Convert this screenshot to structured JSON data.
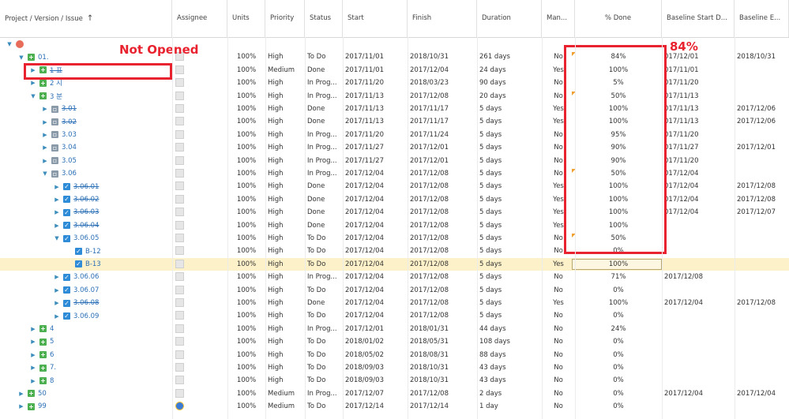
{
  "columns": [
    {
      "key": "name",
      "label": "Project / Version / Issue",
      "sort_icon": "↑"
    },
    {
      "key": "assignee",
      "label": "Assignee"
    },
    {
      "key": "units",
      "label": "Units"
    },
    {
      "key": "priority",
      "label": "Priority"
    },
    {
      "key": "status",
      "label": "Status"
    },
    {
      "key": "start",
      "label": "Start"
    },
    {
      "key": "finish",
      "label": "Finish"
    },
    {
      "key": "duration",
      "label": "Duration"
    },
    {
      "key": "manual",
      "label": "Man..."
    },
    {
      "key": "done",
      "label": "% Done"
    },
    {
      "key": "bstart",
      "label": "Baseline Start D..."
    },
    {
      "key": "bend",
      "label": "Baseline E..."
    }
  ],
  "rows": [
    {
      "level": 0,
      "arrow": "down",
      "icon": "proj",
      "name": "",
      "strike": false,
      "units": "",
      "priority": "",
      "status": "",
      "start": "",
      "finish": "",
      "duration": "",
      "manual": "",
      "done": "",
      "bstart": "",
      "bend": "",
      "flag": false,
      "avatar": false
    },
    {
      "level": 1,
      "arrow": "down",
      "icon": "plus",
      "name": "01.",
      "strike": false,
      "units": "100%",
      "priority": "High",
      "status": "To Do",
      "start": "2017/11/01",
      "finish": "2018/10/31",
      "duration": "261 days",
      "manual": "No",
      "done": "84%",
      "bstart": "017/12/01",
      "bend": "2018/10/31",
      "flag": true,
      "avatar": true
    },
    {
      "level": 2,
      "arrow": "right",
      "icon": "plus",
      "name": "1 표",
      "strike": true,
      "units": "100%",
      "priority": "Medium",
      "status": "Done",
      "start": "2017/11/01",
      "finish": "2017/12/04",
      "duration": "24 days",
      "manual": "Yes",
      "done": "100%",
      "bstart": "017/11/01",
      "bend": "",
      "flag": false,
      "avatar": true
    },
    {
      "level": 2,
      "arrow": "right",
      "icon": "plus",
      "name": "2 시",
      "strike": false,
      "units": "100%",
      "priority": "High",
      "status": "In Prog...",
      "start": "2017/11/20",
      "finish": "2018/03/23",
      "duration": "90 days",
      "manual": "No",
      "done": "5%",
      "bstart": "017/11/20",
      "bend": "",
      "flag": false,
      "avatar": true
    },
    {
      "level": 2,
      "arrow": "down",
      "icon": "plus",
      "name": "3 분",
      "strike": false,
      "units": "100%",
      "priority": "High",
      "status": "In Prog...",
      "start": "2017/11/13",
      "finish": "2017/12/08",
      "duration": "20 days",
      "manual": "No",
      "done": "50%",
      "bstart": "017/11/13",
      "bend": "",
      "flag": true,
      "avatar": true
    },
    {
      "level": 3,
      "arrow": "right",
      "icon": "task",
      "name": "3.01",
      "strike": true,
      "units": "100%",
      "priority": "High",
      "status": "Done",
      "start": "2017/11/13",
      "finish": "2017/11/17",
      "duration": "5 days",
      "manual": "Yes",
      "done": "100%",
      "bstart": "017/11/13",
      "bend": "2017/12/06",
      "flag": false,
      "avatar": true
    },
    {
      "level": 3,
      "arrow": "right",
      "icon": "task",
      "name": "3.02",
      "strike": true,
      "units": "100%",
      "priority": "High",
      "status": "Done",
      "start": "2017/11/13",
      "finish": "2017/11/17",
      "duration": "5 days",
      "manual": "Yes",
      "done": "100%",
      "bstart": "017/11/13",
      "bend": "2017/12/06",
      "flag": false,
      "avatar": true
    },
    {
      "level": 3,
      "arrow": "right",
      "icon": "task",
      "name": "3.03",
      "strike": false,
      "units": "100%",
      "priority": "High",
      "status": "In Prog...",
      "start": "2017/11/20",
      "finish": "2017/11/24",
      "duration": "5 days",
      "manual": "No",
      "done": "95%",
      "bstart": "017/11/20",
      "bend": "",
      "flag": false,
      "avatar": true
    },
    {
      "level": 3,
      "arrow": "right",
      "icon": "task",
      "name": "3.04",
      "strike": false,
      "units": "100%",
      "priority": "High",
      "status": "In Prog...",
      "start": "2017/11/27",
      "finish": "2017/12/01",
      "duration": "5 days",
      "manual": "No",
      "done": "90%",
      "bstart": "017/11/27",
      "bend": "2017/12/01",
      "flag": false,
      "avatar": true
    },
    {
      "level": 3,
      "arrow": "right",
      "icon": "task",
      "name": "3.05",
      "strike": false,
      "units": "100%",
      "priority": "High",
      "status": "In Prog...",
      "start": "2017/11/27",
      "finish": "2017/12/01",
      "duration": "5 days",
      "manual": "No",
      "done": "90%",
      "bstart": "017/11/20",
      "bend": "",
      "flag": false,
      "avatar": true
    },
    {
      "level": 3,
      "arrow": "down",
      "icon": "task",
      "name": "3.06",
      "strike": false,
      "units": "100%",
      "priority": "High",
      "status": "In Prog...",
      "start": "2017/12/04",
      "finish": "2017/12/08",
      "duration": "5 days",
      "manual": "No",
      "done": "50%",
      "bstart": "017/12/04",
      "bend": "",
      "flag": true,
      "avatar": true
    },
    {
      "level": 4,
      "arrow": "right",
      "icon": "check",
      "name": "3.06.01",
      "strike": true,
      "units": "100%",
      "priority": "High",
      "status": "Done",
      "start": "2017/12/04",
      "finish": "2017/12/08",
      "duration": "5 days",
      "manual": "Yes",
      "done": "100%",
      "bstart": "017/12/04",
      "bend": "2017/12/08",
      "flag": false,
      "avatar": true
    },
    {
      "level": 4,
      "arrow": "right",
      "icon": "check",
      "name": "3.06.02",
      "strike": true,
      "units": "100%",
      "priority": "High",
      "status": "Done",
      "start": "2017/12/04",
      "finish": "2017/12/08",
      "duration": "5 days",
      "manual": "Yes",
      "done": "100%",
      "bstart": "017/12/04",
      "bend": "2017/12/08",
      "flag": false,
      "avatar": true
    },
    {
      "level": 4,
      "arrow": "right",
      "icon": "check",
      "name": "3.06.03",
      "strike": true,
      "units": "100%",
      "priority": "High",
      "status": "Done",
      "start": "2017/12/04",
      "finish": "2017/12/08",
      "duration": "5 days",
      "manual": "Yes",
      "done": "100%",
      "bstart": "017/12/04",
      "bend": "2017/12/07",
      "flag": false,
      "avatar": true
    },
    {
      "level": 4,
      "arrow": "right",
      "icon": "check",
      "name": "3.06.04",
      "strike": true,
      "units": "100%",
      "priority": "High",
      "status": "Done",
      "start": "2017/12/04",
      "finish": "2017/12/08",
      "duration": "5 days",
      "manual": "Yes",
      "done": "100%",
      "bstart": "",
      "bend": "",
      "flag": false,
      "avatar": true
    },
    {
      "level": 4,
      "arrow": "down",
      "icon": "check",
      "name": "3.06.05",
      "strike": false,
      "units": "100%",
      "priority": "High",
      "status": "To Do",
      "start": "2017/12/04",
      "finish": "2017/12/08",
      "duration": "5 days",
      "manual": "No",
      "done": "50%",
      "bstart": "",
      "bend": "",
      "flag": true,
      "avatar": true
    },
    {
      "level": 5,
      "arrow": "",
      "icon": "check",
      "name": "B-12",
      "strike": false,
      "units": "100%",
      "priority": "High",
      "status": "To Do",
      "start": "2017/12/04",
      "finish": "2017/12/08",
      "duration": "5 days",
      "manual": "No",
      "done": "0%",
      "bstart": "",
      "bend": "",
      "flag": false,
      "avatar": true
    },
    {
      "level": 5,
      "arrow": "",
      "icon": "check",
      "name": "B-13",
      "strike": false,
      "units": "100%",
      "priority": "High",
      "status": "To Do",
      "start": "2017/12/04",
      "finish": "2017/12/08",
      "duration": "5 days",
      "manual": "Yes",
      "done": "100%",
      "bstart": "",
      "bend": "",
      "flag": false,
      "avatar": true,
      "selected": true
    },
    {
      "level": 4,
      "arrow": "right",
      "icon": "check",
      "name": "3.06.06",
      "strike": false,
      "units": "100%",
      "priority": "High",
      "status": "In Prog...",
      "start": "2017/12/04",
      "finish": "2017/12/08",
      "duration": "5 days",
      "manual": "No",
      "done": "71%",
      "bstart": "2017/12/08",
      "bend": "",
      "flag": false,
      "avatar": true
    },
    {
      "level": 4,
      "arrow": "right",
      "icon": "check",
      "name": "3.06.07",
      "strike": false,
      "units": "100%",
      "priority": "High",
      "status": "To Do",
      "start": "2017/12/04",
      "finish": "2017/12/08",
      "duration": "5 days",
      "manual": "No",
      "done": "0%",
      "bstart": "",
      "bend": "",
      "flag": false,
      "avatar": true
    },
    {
      "level": 4,
      "arrow": "right",
      "icon": "check",
      "name": "3.06.08",
      "strike": true,
      "units": "100%",
      "priority": "High",
      "status": "Done",
      "start": "2017/12/04",
      "finish": "2017/12/08",
      "duration": "5 days",
      "manual": "Yes",
      "done": "100%",
      "bstart": "2017/12/04",
      "bend": "2017/12/08",
      "flag": false,
      "avatar": true
    },
    {
      "level": 4,
      "arrow": "right",
      "icon": "check",
      "name": "3.06.09",
      "strike": false,
      "units": "100%",
      "priority": "High",
      "status": "To Do",
      "start": "2017/12/04",
      "finish": "2017/12/08",
      "duration": "5 days",
      "manual": "No",
      "done": "0%",
      "bstart": "",
      "bend": "",
      "flag": false,
      "avatar": true
    },
    {
      "level": 2,
      "arrow": "right",
      "icon": "plus",
      "name": "4",
      "strike": false,
      "units": "100%",
      "priority": "High",
      "status": "In Prog...",
      "start": "2017/12/01",
      "finish": "2018/01/31",
      "duration": "44 days",
      "manual": "No",
      "done": "24%",
      "bstart": "",
      "bend": "",
      "flag": false,
      "avatar": true
    },
    {
      "level": 2,
      "arrow": "right",
      "icon": "plus",
      "name": "5",
      "strike": false,
      "units": "100%",
      "priority": "High",
      "status": "To Do",
      "start": "2018/01/02",
      "finish": "2018/05/31",
      "duration": "108 days",
      "manual": "No",
      "done": "0%",
      "bstart": "",
      "bend": "",
      "flag": false,
      "avatar": true
    },
    {
      "level": 2,
      "arrow": "right",
      "icon": "plus",
      "name": "6",
      "strike": false,
      "units": "100%",
      "priority": "High",
      "status": "To Do",
      "start": "2018/05/02",
      "finish": "2018/08/31",
      "duration": "88 days",
      "manual": "No",
      "done": "0%",
      "bstart": "",
      "bend": "",
      "flag": false,
      "avatar": true
    },
    {
      "level": 2,
      "arrow": "right",
      "icon": "plus",
      "name": "7.",
      "strike": false,
      "units": "100%",
      "priority": "High",
      "status": "To Do",
      "start": "2018/09/03",
      "finish": "2018/10/31",
      "duration": "43 days",
      "manual": "No",
      "done": "0%",
      "bstart": "",
      "bend": "",
      "flag": false,
      "avatar": true
    },
    {
      "level": 2,
      "arrow": "right",
      "icon": "plus",
      "name": "8",
      "strike": false,
      "units": "100%",
      "priority": "High",
      "status": "To Do",
      "start": "2018/09/03",
      "finish": "2018/10/31",
      "duration": "43 days",
      "manual": "No",
      "done": "0%",
      "bstart": "",
      "bend": "",
      "flag": false,
      "avatar": true
    },
    {
      "level": 1,
      "arrow": "right",
      "icon": "plus",
      "name": "50",
      "strike": false,
      "units": "100%",
      "priority": "Medium",
      "status": "In Prog...",
      "start": "2017/12/07",
      "finish": "2017/12/08",
      "duration": "2 days",
      "manual": "No",
      "done": "0%",
      "bstart": "2017/12/04",
      "bend": "2017/12/04",
      "flag": false,
      "avatar": true
    },
    {
      "level": 1,
      "arrow": "right",
      "icon": "plus",
      "name": "99",
      "strike": false,
      "units": "100%",
      "priority": "Medium",
      "status": "To Do",
      "start": "2017/12/14",
      "finish": "2017/12/14",
      "duration": "1 day",
      "manual": "No",
      "done": "0%",
      "bstart": "",
      "bend": "",
      "flag": false,
      "avatar": "user"
    }
  ],
  "annotations": {
    "not_opened": "Not Opened",
    "done_callout": "84%"
  },
  "colors": {
    "annotation": "#e8232f",
    "link": "#2b6fb6",
    "selected_row": "#fdf1c9"
  }
}
